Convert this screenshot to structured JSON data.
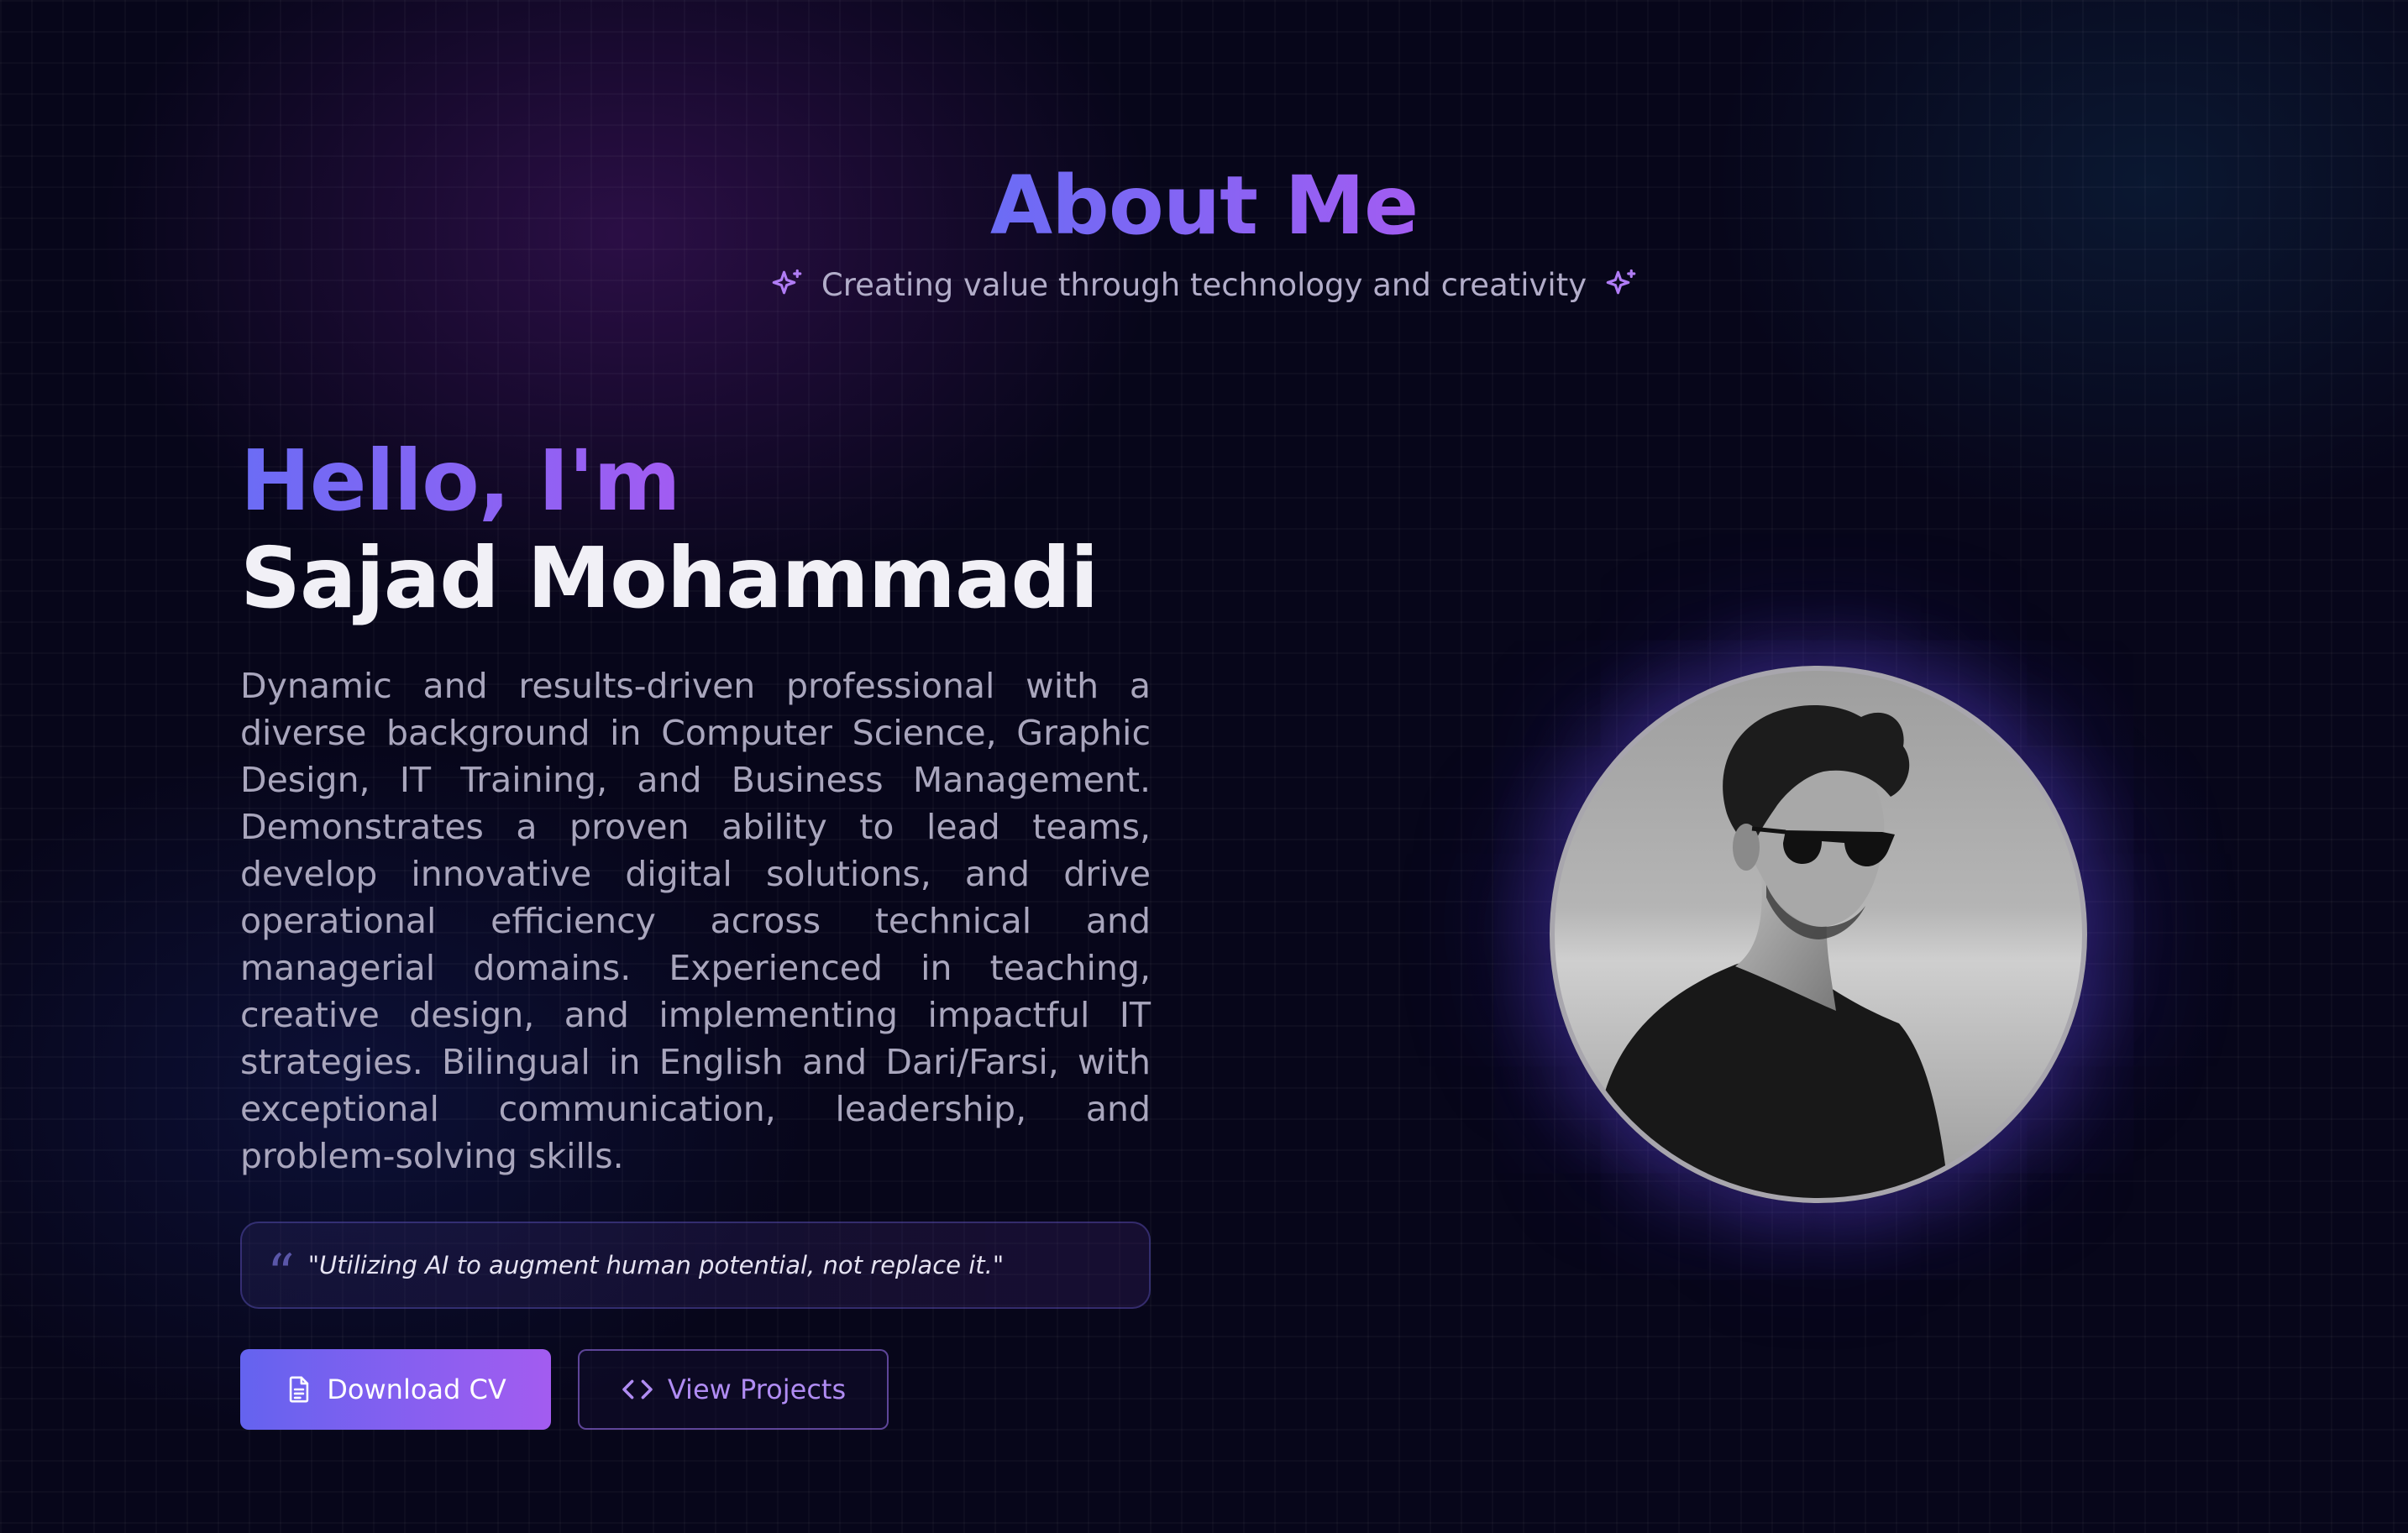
{
  "header": {
    "title": "About Me",
    "subtitle": "Creating value through technology and creativity",
    "icons": [
      "sparkle-icon",
      "sparkle-icon"
    ]
  },
  "intro": {
    "greeting": "Hello, I'm",
    "name": "Sajad Mohammadi",
    "bio": "Dynamic and results-driven professional with a diverse background in Computer Science, Graphic Design, IT Training, and Business Management. Demonstrates a proven ability to lead teams, develop innovative digital solutions, and drive operational efficiency across technical and managerial domains. Experienced in teaching, creative design, and implementing impactful IT strategies. Bilingual in English and Dari/Farsi, with exceptional communication, leadership, and problem-solving skills."
  },
  "quote": {
    "icon": "quote-icon",
    "text": "\"Utilizing AI to augment human potential, not replace it.\""
  },
  "actions": {
    "download_label": "Download CV",
    "download_icon": "document-icon",
    "projects_label": "View Projects",
    "projects_icon": "code-icon"
  },
  "profile": {
    "photo": "profile-photo"
  },
  "colors": {
    "background": "#07061a",
    "accent_start": "#6b6cf5",
    "accent_end": "#a25cf2",
    "text_primary": "#f1f0f6",
    "text_muted": "#a9a6bd"
  }
}
